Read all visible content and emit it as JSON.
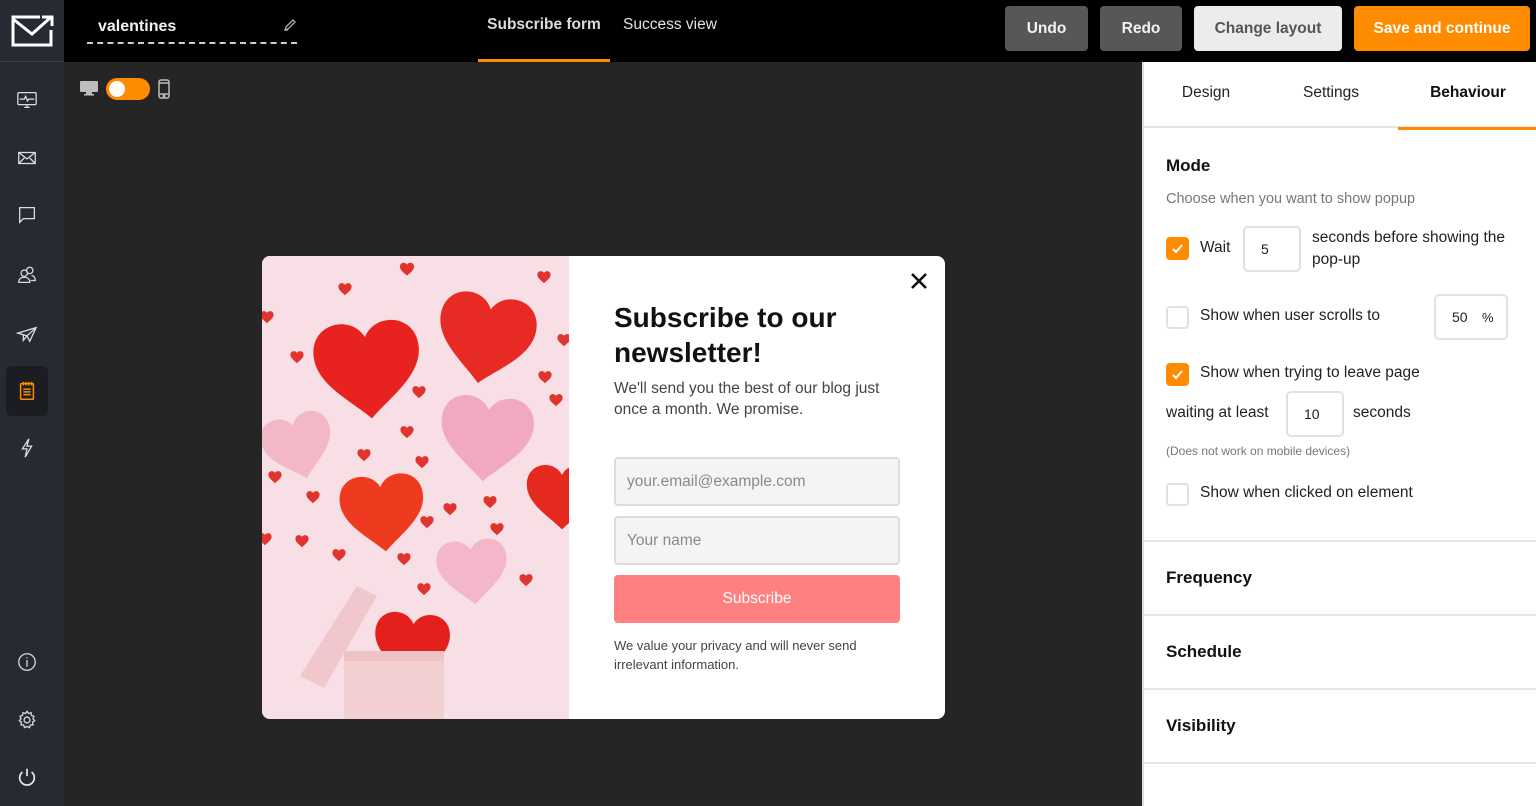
{
  "app": {
    "form_name": "valentines",
    "accent_color": "#ff8c00"
  },
  "sidebar": {
    "items": [
      {
        "icon": "monitor-pulse-icon",
        "name": "dashboard"
      },
      {
        "icon": "envelope-icon",
        "name": "campaigns"
      },
      {
        "icon": "chat-bubble-icon",
        "name": "messages"
      },
      {
        "icon": "users-icon",
        "name": "subscribers"
      },
      {
        "icon": "paper-plane-icon",
        "name": "automation"
      },
      {
        "icon": "notepad-icon",
        "name": "forms",
        "active": true
      },
      {
        "icon": "lightning-icon",
        "name": "integrations"
      }
    ],
    "bottom_items": [
      {
        "icon": "info-icon",
        "name": "info"
      },
      {
        "icon": "gear-icon",
        "name": "settings"
      },
      {
        "icon": "power-icon",
        "name": "logout"
      }
    ]
  },
  "topbar": {
    "view_tabs": [
      {
        "label": "Subscribe form",
        "active": true
      },
      {
        "label": "Success view",
        "active": false
      }
    ],
    "buttons": {
      "undo": "Undo",
      "redo": "Redo",
      "change_layout": "Change layout",
      "save": "Save and continue"
    }
  },
  "canvas": {
    "device_toggle": {
      "left_icon": "desktop-icon",
      "right_icon": "mobile-icon",
      "state": "on"
    }
  },
  "popup": {
    "title": "Subscribe to our newsletter!",
    "subtitle": "We'll send you the best of our blog just once a month. We promise.",
    "email_placeholder": "your.email@example.com",
    "name_placeholder": "Your name",
    "button_label": "Subscribe",
    "privacy_text": "We value your privacy and will never send irrelevant information.",
    "button_color": "#ff8080"
  },
  "panel": {
    "tabs": [
      {
        "label": "Design",
        "active": false
      },
      {
        "label": "Settings",
        "active": false
      },
      {
        "label": "Behaviour",
        "active": true
      }
    ],
    "mode": {
      "heading": "Mode",
      "description": "Choose when you want to show popup",
      "wait": {
        "checked": true,
        "label": "Wait",
        "value": "5",
        "suffix": "seconds before showing the pop-up"
      },
      "scroll": {
        "checked": false,
        "label": "Show when user scrolls to",
        "value": "50",
        "unit": "%"
      },
      "leave": {
        "checked": true,
        "label": "Show when trying to leave page",
        "prefix": "waiting at least",
        "value": "10",
        "suffix": "seconds",
        "note": "(Does not work on mobile devices)"
      },
      "click": {
        "checked": false,
        "label": "Show when clicked on element"
      }
    },
    "sections": [
      "Frequency",
      "Schedule",
      "Visibility"
    ]
  }
}
